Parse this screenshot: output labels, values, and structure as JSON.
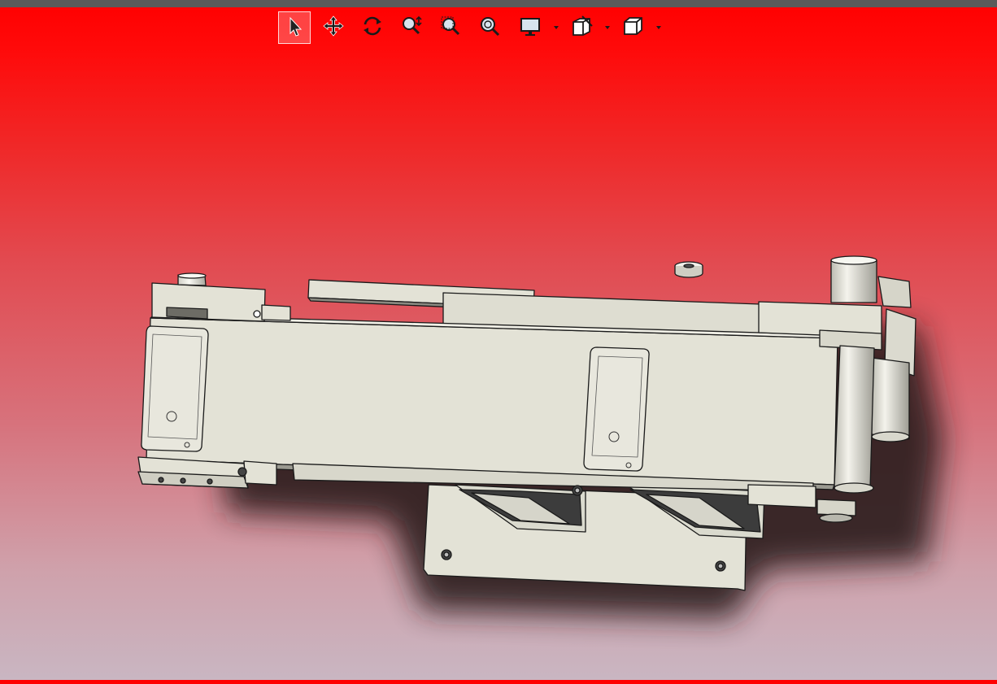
{
  "window": {
    "top_strip_color": "#5a5a5a",
    "background_top_color": "#ff0000",
    "background_bottom_color": "#c9b6c2"
  },
  "toolbar": {
    "items": [
      {
        "icon": "select-arrow-icon",
        "active": true
      },
      {
        "icon": "pan-move-icon"
      },
      {
        "icon": "rotate-view-icon"
      },
      {
        "icon": "zoom-in-out-icon"
      },
      {
        "icon": "zoom-to-area-icon"
      },
      {
        "icon": "zoom-to-fit-icon"
      },
      {
        "icon": "display-style-icon",
        "has_dropdown": true
      },
      {
        "icon": "section-view-icon",
        "has_dropdown": true
      },
      {
        "icon": "view-orientation-cube-icon",
        "has_dropdown": true
      }
    ]
  },
  "model": {
    "part_color": "#e3e2d6",
    "shadow_color": "#2a1a1c"
  }
}
